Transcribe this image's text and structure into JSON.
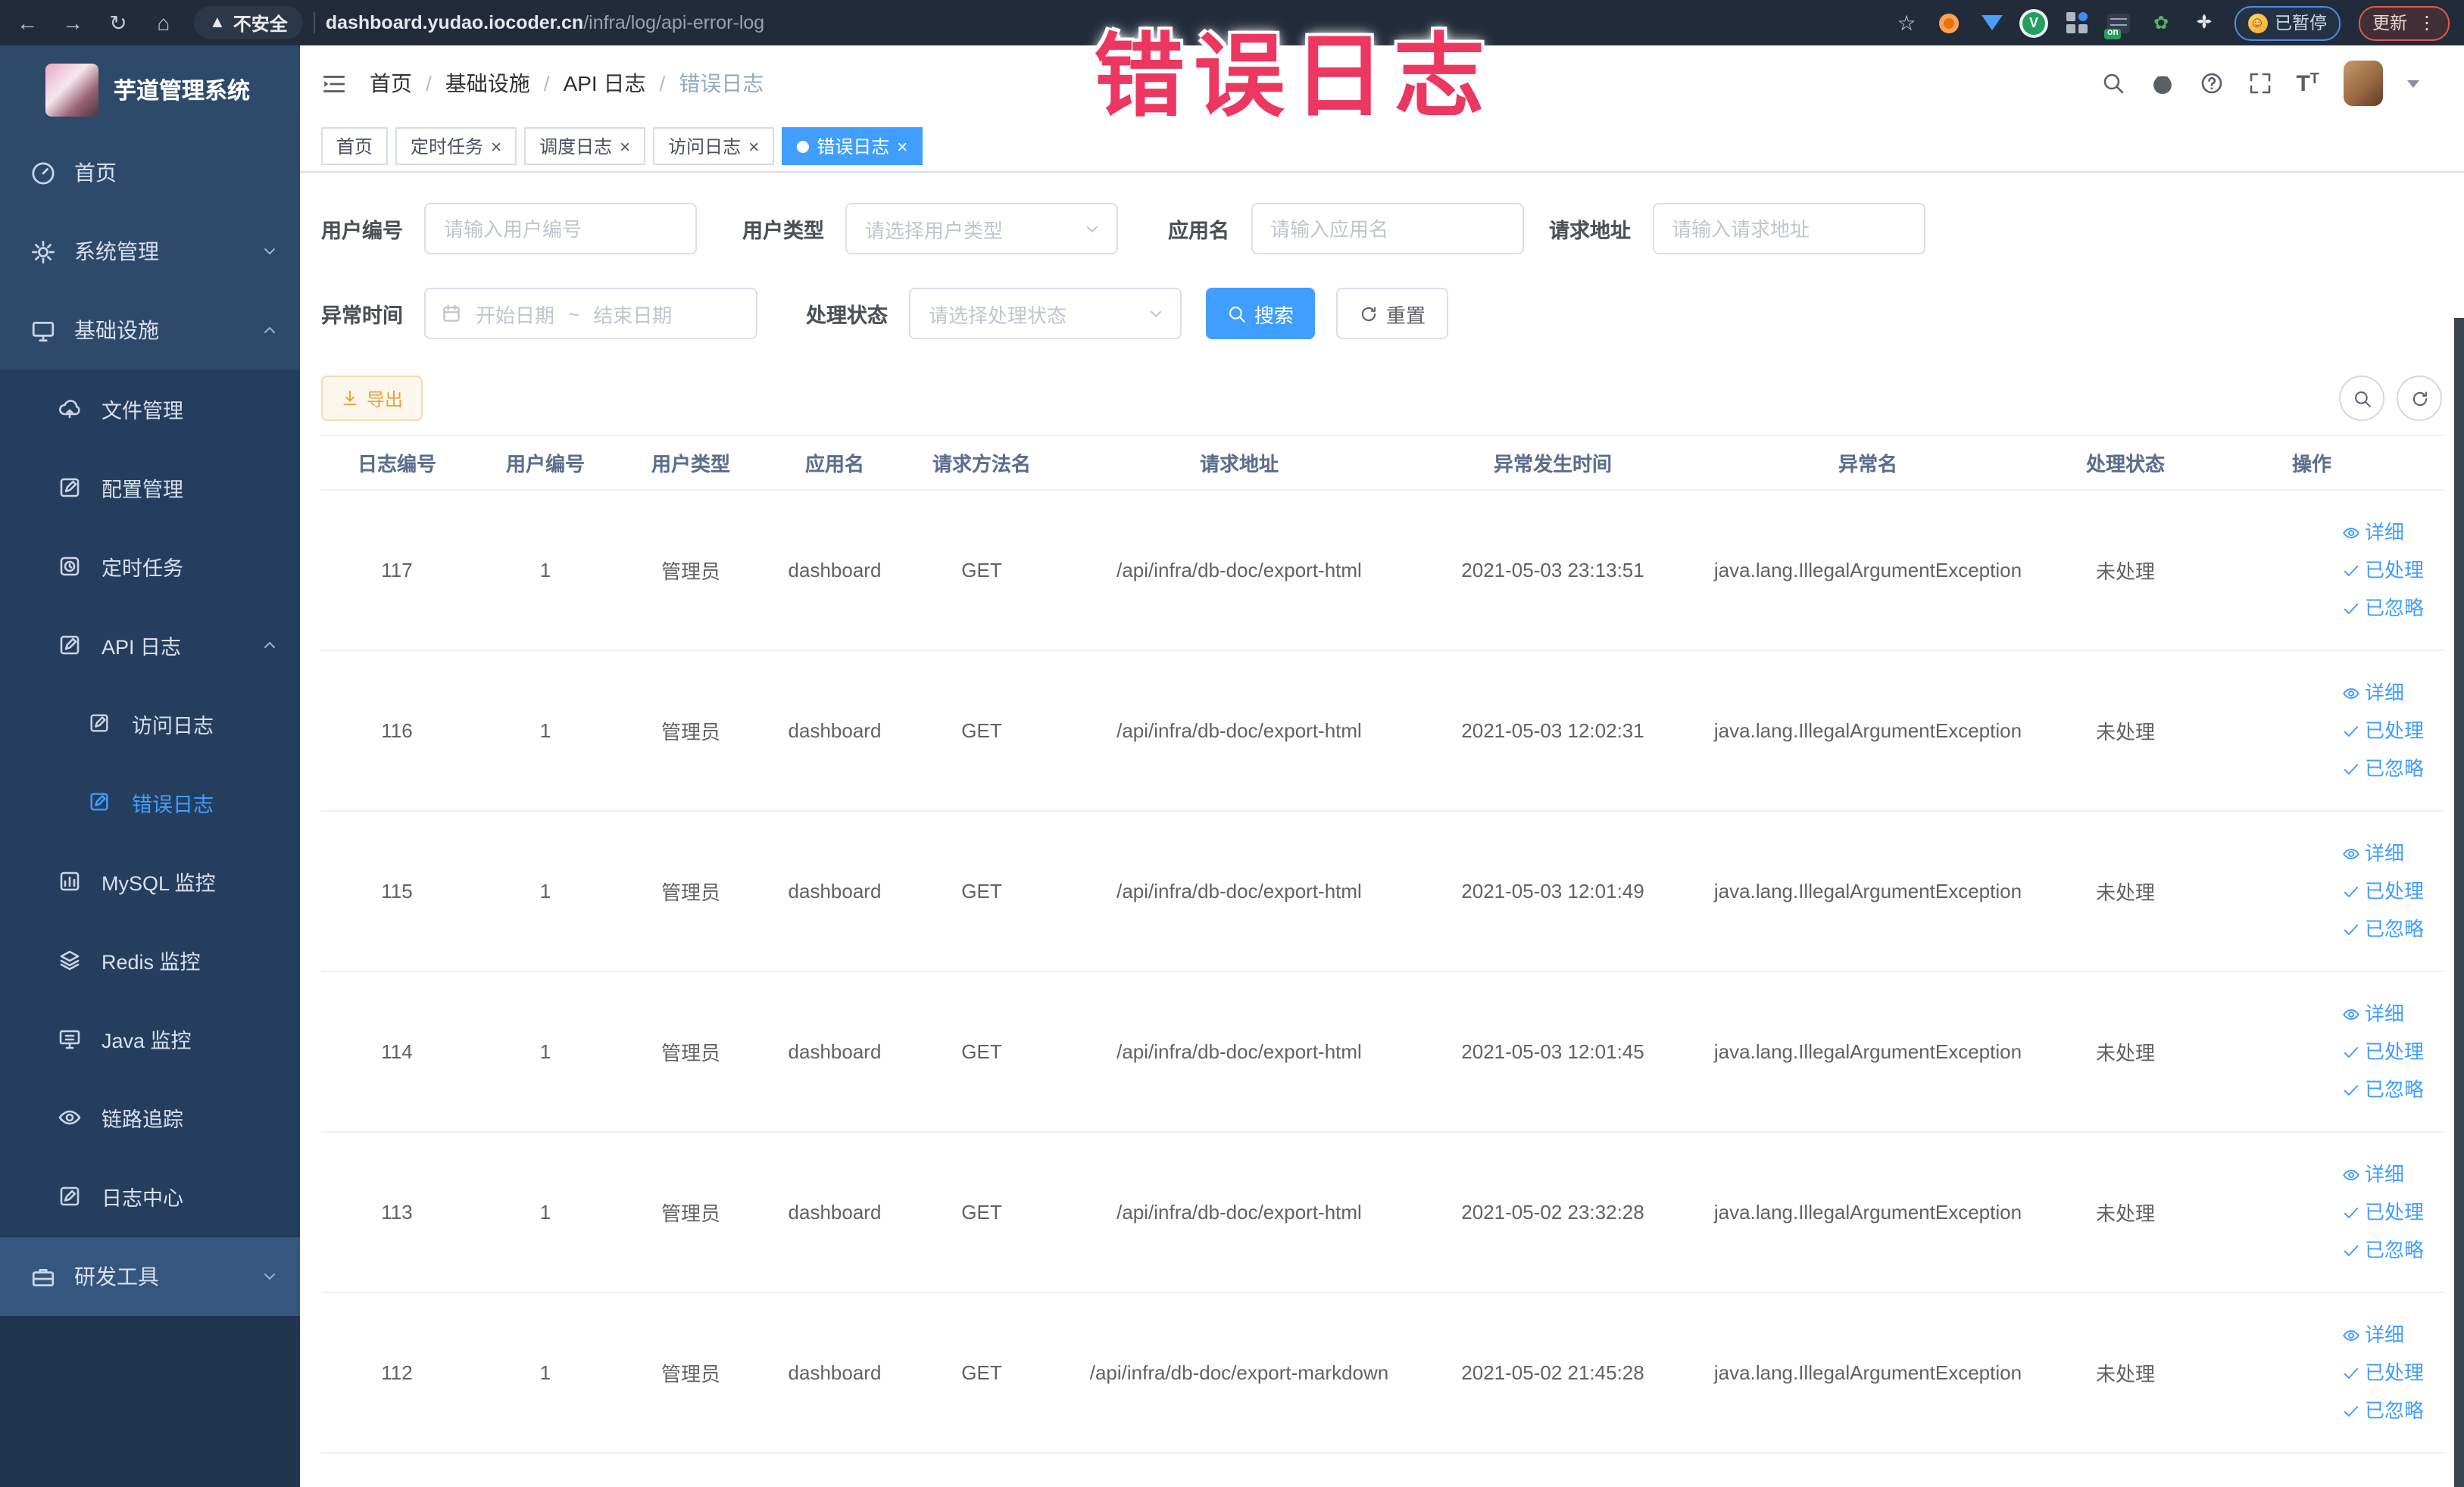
{
  "browser": {
    "security_label": "不安全",
    "url_host": "dashboard.yudao.iocoder.cn",
    "url_path": "/infra/log/api-error-log",
    "paused_label": "已暂停",
    "update_label": "更新"
  },
  "overlay": {
    "text": "错误日志",
    "color": "#ec3760"
  },
  "sidebar": {
    "title": "芋道管理系统",
    "items": [
      {
        "label": "首页"
      },
      {
        "label": "系统管理"
      },
      {
        "label": "基础设施"
      },
      {
        "label": "文件管理"
      },
      {
        "label": "配置管理"
      },
      {
        "label": "定时任务"
      },
      {
        "label": "API 日志"
      },
      {
        "label": "访问日志"
      },
      {
        "label": "错误日志"
      },
      {
        "label": "MySQL 监控"
      },
      {
        "label": "Redis 监控"
      },
      {
        "label": "Java 监控"
      },
      {
        "label": "链路追踪"
      },
      {
        "label": "日志中心"
      },
      {
        "label": "研发工具"
      }
    ]
  },
  "breadcrumb": {
    "items": [
      "首页",
      "基础设施",
      "API 日志",
      "错误日志"
    ]
  },
  "tabs": [
    {
      "label": "首页",
      "closable": false,
      "active": false
    },
    {
      "label": "定时任务",
      "closable": true,
      "active": false
    },
    {
      "label": "调度日志",
      "closable": true,
      "active": false
    },
    {
      "label": "访问日志",
      "closable": true,
      "active": false
    },
    {
      "label": "错误日志",
      "closable": true,
      "active": true
    }
  ],
  "filters": {
    "user_id": {
      "label": "用户编号",
      "placeholder": "请输入用户编号",
      "value": ""
    },
    "user_type": {
      "label": "用户类型",
      "placeholder": "请选择用户类型"
    },
    "app_name": {
      "label": "应用名",
      "placeholder": "请输入应用名",
      "value": ""
    },
    "request_url": {
      "label": "请求地址",
      "placeholder": "请输入请求地址",
      "value": ""
    },
    "exception_time": {
      "label": "异常时间",
      "start_placeholder": "开始日期",
      "separator": "~",
      "end_placeholder": "结束日期"
    },
    "process_status": {
      "label": "处理状态",
      "placeholder": "请选择处理状态"
    },
    "search_label": "搜索",
    "reset_label": "重置"
  },
  "toolbar": {
    "export_label": "导出"
  },
  "table": {
    "columns": [
      "日志编号",
      "用户编号",
      "用户类型",
      "应用名",
      "请求方法名",
      "请求地址",
      "异常发生时间",
      "异常名",
      "处理状态",
      "操作"
    ],
    "row_actions": [
      "详细",
      "已处理",
      "已忽略"
    ],
    "rows": [
      {
        "id": "117",
        "user_id": "1",
        "user_type": "管理员",
        "app": "dashboard",
        "method": "GET",
        "url": "/api/infra/db-doc/export-html",
        "time": "2021-05-03 23:13:51",
        "exception": "java.lang.IllegalArgumentException",
        "status": "未处理"
      },
      {
        "id": "116",
        "user_id": "1",
        "user_type": "管理员",
        "app": "dashboard",
        "method": "GET",
        "url": "/api/infra/db-doc/export-html",
        "time": "2021-05-03 12:02:31",
        "exception": "java.lang.IllegalArgumentException",
        "status": "未处理"
      },
      {
        "id": "115",
        "user_id": "1",
        "user_type": "管理员",
        "app": "dashboard",
        "method": "GET",
        "url": "/api/infra/db-doc/export-html",
        "time": "2021-05-03 12:01:49",
        "exception": "java.lang.IllegalArgumentException",
        "status": "未处理"
      },
      {
        "id": "114",
        "user_id": "1",
        "user_type": "管理员",
        "app": "dashboard",
        "method": "GET",
        "url": "/api/infra/db-doc/export-html",
        "time": "2021-05-03 12:01:45",
        "exception": "java.lang.IllegalArgumentException",
        "status": "未处理"
      },
      {
        "id": "113",
        "user_id": "1",
        "user_type": "管理员",
        "app": "dashboard",
        "method": "GET",
        "url": "/api/infra/db-doc/export-html",
        "time": "2021-05-02 23:32:28",
        "exception": "java.lang.IllegalArgumentException",
        "status": "未处理"
      },
      {
        "id": "112",
        "user_id": "1",
        "user_type": "管理员",
        "app": "dashboard",
        "method": "GET",
        "url": "/api/infra/db-doc/export-markdown",
        "time": "2021-05-02 21:45:28",
        "exception": "java.lang.IllegalArgumentException",
        "status": "未处理"
      }
    ]
  }
}
